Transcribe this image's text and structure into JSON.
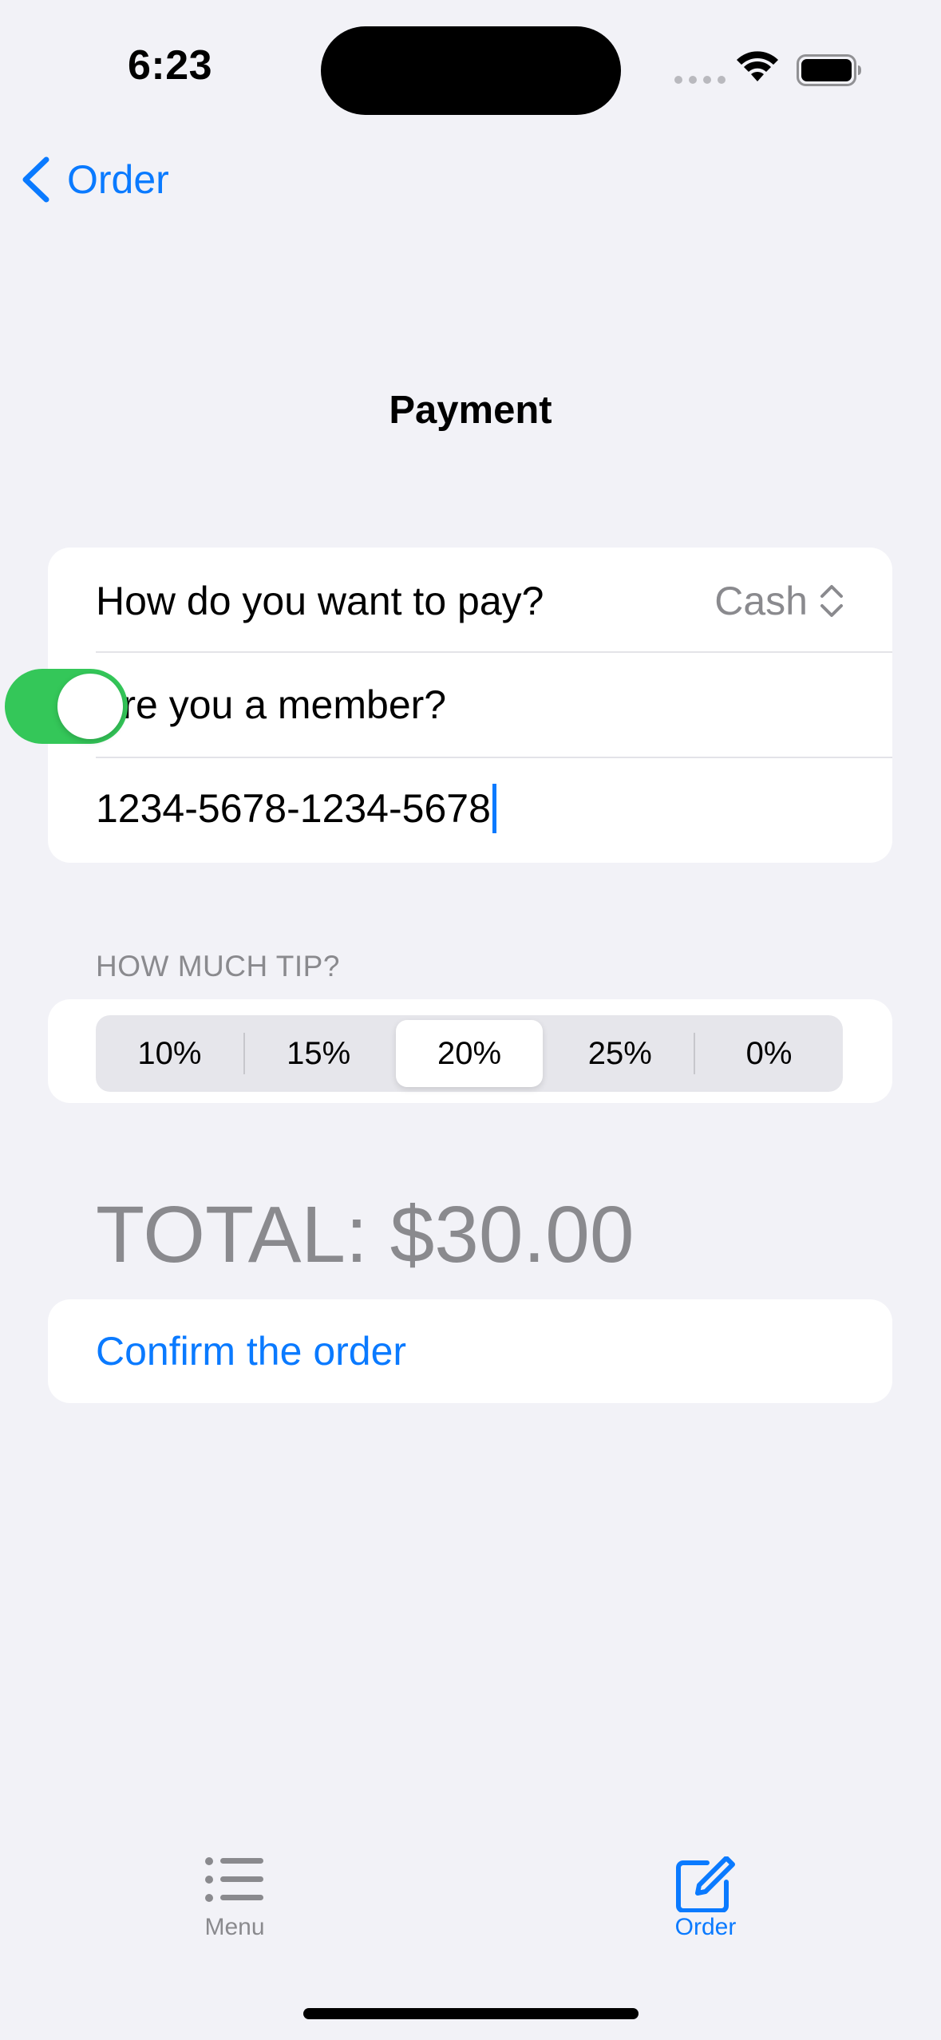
{
  "status_bar": {
    "time": "6:23"
  },
  "nav": {
    "back_label": "Order",
    "title": "Payment"
  },
  "payment_section": {
    "pay_label": "How do you want to pay?",
    "pay_value": "Cash",
    "member_label": "Are you a member?",
    "member_toggle_on": true,
    "member_number": "1234-5678-1234-5678"
  },
  "tip_section": {
    "header": "HOW MUCH TIP?",
    "options": [
      "10%",
      "15%",
      "20%",
      "25%",
      "0%"
    ],
    "selected": "20%"
  },
  "total_text": "TOTAL: $30.00",
  "confirm_label": "Confirm the order",
  "tab_bar": {
    "tabs": [
      {
        "label": "Menu",
        "active": false
      },
      {
        "label": "Order",
        "active": true
      }
    ]
  },
  "colors": {
    "accent": "#0A7AFF",
    "toggle_on": "#34C759",
    "secondary": "#8A8A8E",
    "background": "#F2F2F7"
  }
}
